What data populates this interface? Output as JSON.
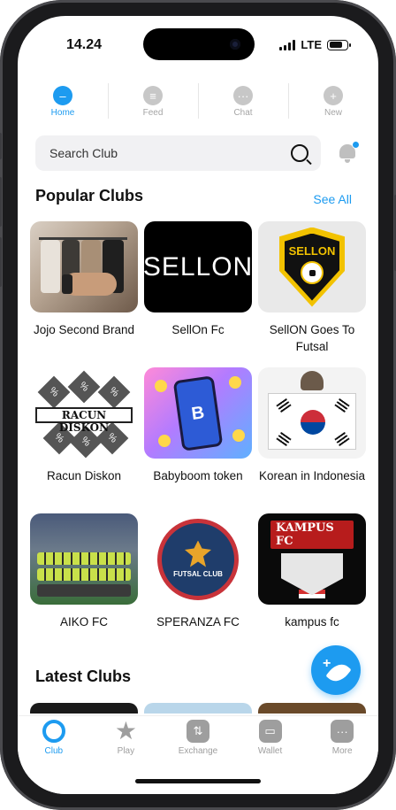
{
  "status_bar": {
    "time": "14.24",
    "network": "LTE"
  },
  "top_nav": [
    {
      "label": "Home",
      "icon": "home-icon",
      "glyph": "–",
      "active": true
    },
    {
      "label": "Feed",
      "icon": "feed-icon",
      "glyph": "≡",
      "active": false
    },
    {
      "label": "Chat",
      "icon": "chat-icon",
      "glyph": "···",
      "active": false
    },
    {
      "label": "New",
      "icon": "plus-icon",
      "glyph": "+",
      "active": false
    }
  ],
  "search": {
    "placeholder": "Search Club"
  },
  "popular": {
    "title": "Popular Clubs",
    "see_all": "See All",
    "clubs": [
      {
        "name": "Jojo Second Brand",
        "thumb": "jojo"
      },
      {
        "name": "SellOn Fc",
        "thumb": "sellon",
        "logo_text": "SELLON"
      },
      {
        "name": "SellON Goes To Futsal",
        "thumb": "sellon2",
        "logo_text": "SELLON"
      },
      {
        "name": "Racun Diskon",
        "thumb": "racun",
        "logo_text": "RACUN DISKON"
      },
      {
        "name": "Babyboom token",
        "thumb": "baby",
        "logo_text": "B"
      },
      {
        "name": "Korean in Indonesia",
        "thumb": "korean"
      },
      {
        "name": "AIKO FC",
        "thumb": "aiko"
      },
      {
        "name": "SPERANZA FC",
        "thumb": "speranza",
        "logo_text": "FUTSAL CLUB"
      },
      {
        "name": "kampus fc",
        "thumb": "kampus",
        "logo_text": "KAMPUS FC"
      }
    ]
  },
  "latest": {
    "title": "Latest Clubs"
  },
  "fab": {
    "icon": "new-post-icon",
    "glyph": "+"
  },
  "bottom_nav": [
    {
      "label": "Club",
      "icon": "club-icon",
      "glyph": "",
      "active": true
    },
    {
      "label": "Play",
      "icon": "star-icon",
      "glyph": "★",
      "active": false
    },
    {
      "label": "Exchange",
      "icon": "exchange-icon",
      "glyph": "⇅",
      "active": false
    },
    {
      "label": "Wallet",
      "icon": "wallet-icon",
      "glyph": "▭",
      "active": false
    },
    {
      "label": "More",
      "icon": "more-icon",
      "glyph": "···",
      "active": false
    }
  ],
  "colors": {
    "accent": "#1d9bf0",
    "inactive": "#9e9e9e",
    "frame": "#1b1b1d"
  }
}
